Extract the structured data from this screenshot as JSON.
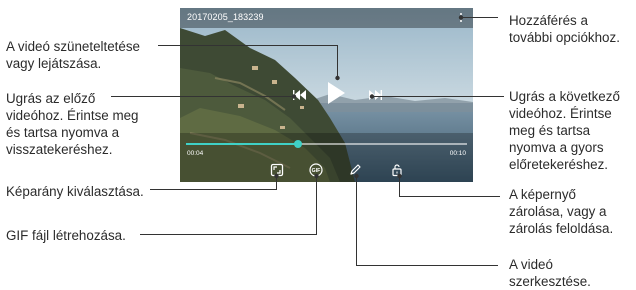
{
  "player": {
    "file_name": "20170205_183239",
    "time_elapsed": "00:04",
    "time_total": "00:10",
    "progress": 0.4,
    "accent_color": "#3fd1c7"
  },
  "icons": {
    "more": "more-options-icon",
    "play": "play-icon",
    "previous": "previous-icon",
    "next": "next-icon",
    "aspect_ratio": "aspect-ratio-icon",
    "gif": "gif-icon",
    "gif_text": "GIF",
    "edit": "edit-icon",
    "lock": "lock-icon"
  },
  "callouts": {
    "more_options": "Hozzáférés a\ntovábbi opciókhoz.",
    "play_pause": "A videó szüneteltetése\nvagy lejátszása.",
    "previous": "Ugrás az előző\nvideóhoz. Érintse meg\nés tartsa nyomva a\nvisszatekeréshez.",
    "next": "Ugrás a következő\nvideóhoz. Érintse\nmeg és tartsa\nnyomva a gyors\nelőretekeréshez.",
    "aspect_ratio": "Képarány kiválasztása.",
    "gif": "GIF fájl létrehozása.",
    "lock": "A képernyő\nzárolása, vagy a\nzárolás feloldása.",
    "edit": "A videó\nszerkesztése."
  }
}
